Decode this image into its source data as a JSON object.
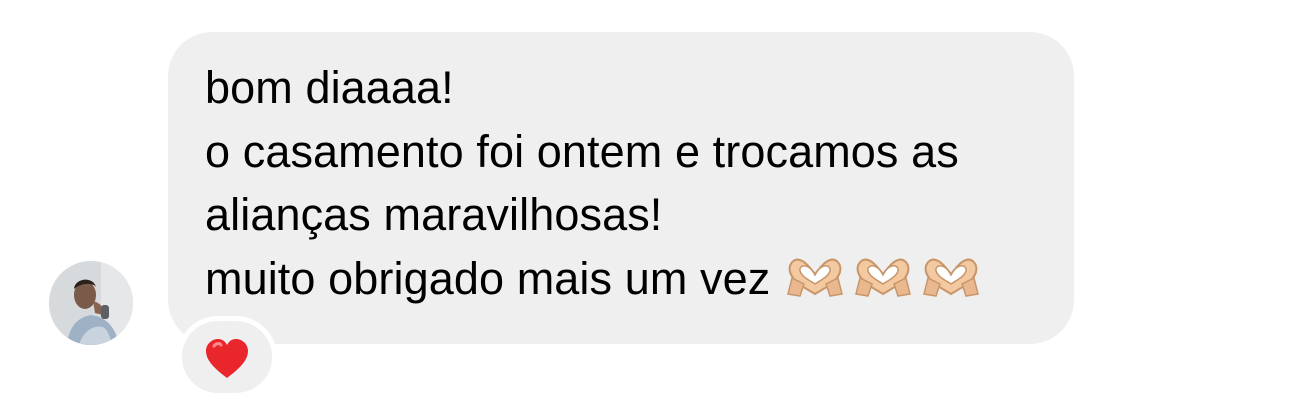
{
  "message": {
    "lines": [
      "bom diaaaa!",
      "o casamento foi ontem e trocamos as",
      "alianças maravilhosas!",
      "muito obrigado mais um vez"
    ],
    "trailing_emoji": [
      "heart-hands-emoji",
      "heart-hands-emoji",
      "heart-hands-emoji"
    ]
  },
  "reaction": {
    "emoji": "red-heart-emoji"
  },
  "colors": {
    "bubble_background": "#efefef",
    "text": "#000000",
    "heart": "#e8262c",
    "background": "#ffffff"
  }
}
